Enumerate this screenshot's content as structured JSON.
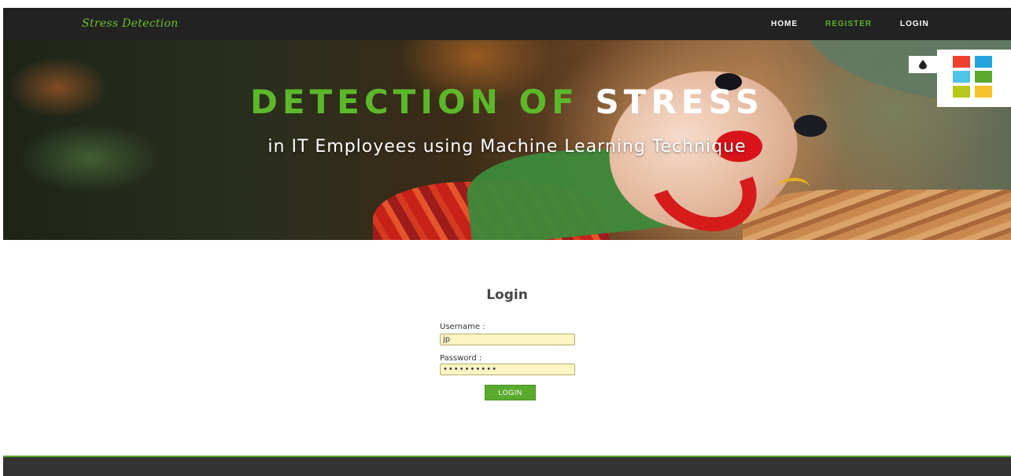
{
  "navbar": {
    "brand": "Stress Detection",
    "links": [
      {
        "label": "HOME"
      },
      {
        "label": "REGISTER"
      },
      {
        "label": "LOGIN"
      }
    ]
  },
  "hero": {
    "title_part_1": "DETECTION OF",
    "title_part_2": "STRESS",
    "subtitle": "in IT Employees using Machine Learning Technique"
  },
  "theme_switcher": {
    "toggle_icon": "drop-icon",
    "swatches": [
      "#f0412e",
      "#23a4dc",
      "#4dc3e8",
      "#5aa82d",
      "#b6c91b",
      "#f7c32a"
    ]
  },
  "login": {
    "heading": "Login",
    "username_label": "Username :",
    "username_value": "jp",
    "password_label": "Password :",
    "password_value": "••••••••••",
    "button_label": "LOGIN"
  },
  "colors": {
    "accent": "#5aaa2d",
    "nav_bg": "#222222",
    "footer_bg": "#333333"
  }
}
